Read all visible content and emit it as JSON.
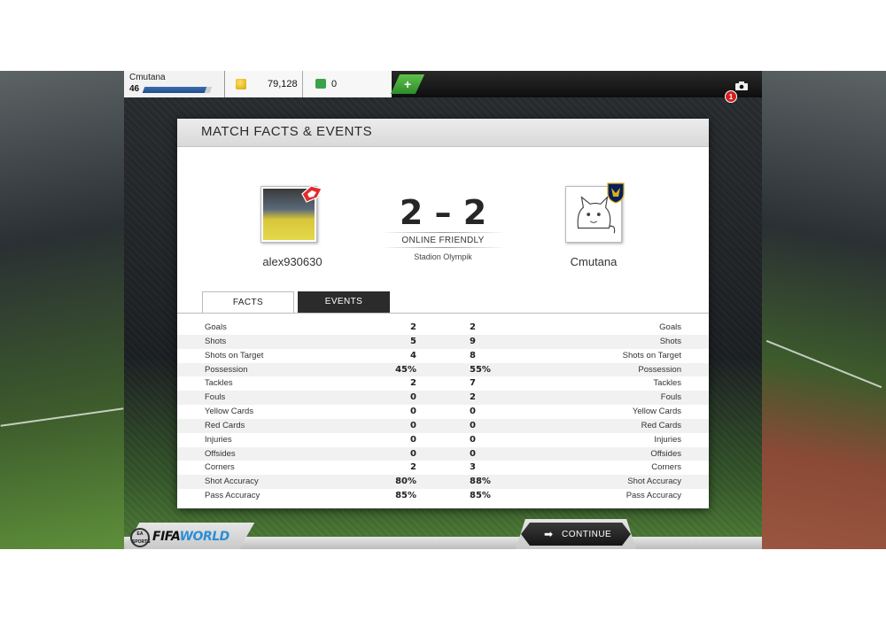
{
  "topbar": {
    "user_name": "Cmutana",
    "level": "46",
    "xp_progress": 0.92,
    "coins": "79,128",
    "points": "0",
    "plus_label": "+",
    "notification_count": "1"
  },
  "panel": {
    "title": "MATCH FACTS & EVENTS",
    "score": "2 – 2",
    "match_type": "ONLINE FRIENDLY",
    "stadium": "Stadion Olympik",
    "home_name": "alex930630",
    "away_name": "Cmutana",
    "tabs": {
      "facts": "FACTS",
      "events": "EVENTS"
    },
    "stats": [
      {
        "label": "Goals",
        "home": "2",
        "away": "2"
      },
      {
        "label": "Shots",
        "home": "5",
        "away": "9"
      },
      {
        "label": "Shots on Target",
        "home": "4",
        "away": "8"
      },
      {
        "label": "Possession",
        "home": "45%",
        "away": "55%"
      },
      {
        "label": "Tackles",
        "home": "2",
        "away": "7"
      },
      {
        "label": "Fouls",
        "home": "0",
        "away": "2"
      },
      {
        "label": "Yellow Cards",
        "home": "0",
        "away": "0"
      },
      {
        "label": "Red Cards",
        "home": "0",
        "away": "0"
      },
      {
        "label": "Injuries",
        "home": "0",
        "away": "0"
      },
      {
        "label": "Offsides",
        "home": "0",
        "away": "0"
      },
      {
        "label": "Corners",
        "home": "2",
        "away": "3"
      },
      {
        "label": "Shot Accuracy",
        "home": "80%",
        "away": "88%"
      },
      {
        "label": "Pass Accuracy",
        "home": "85%",
        "away": "85%"
      }
    ]
  },
  "bottombar": {
    "ea_logo": "EA SPORTS",
    "fifa_prefix": "FIFA",
    "fifa_world": "WORLD",
    "continue_label": "CONTINUE",
    "continue_arrow": "➡"
  },
  "icons": {
    "coin": "coin-icon",
    "points": "fifa-points-icon",
    "camera": "camera-icon"
  }
}
